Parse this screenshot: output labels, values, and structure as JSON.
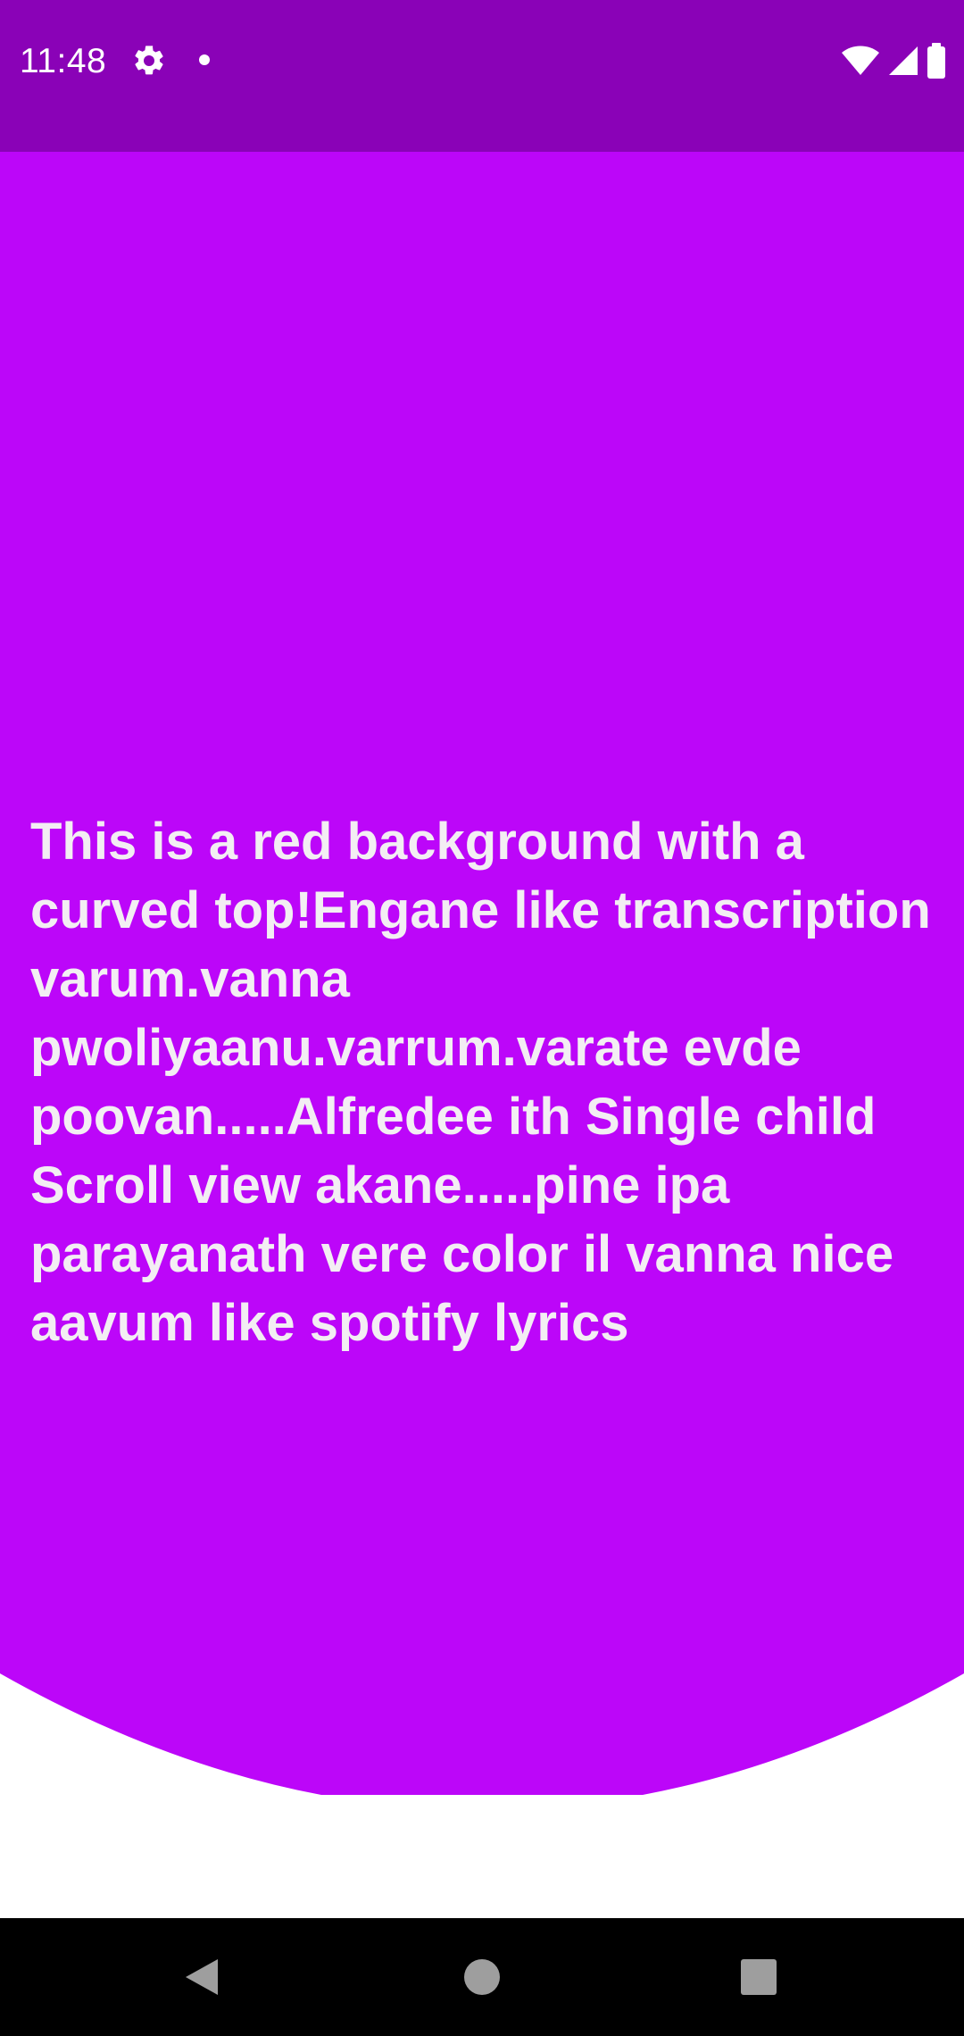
{
  "status_bar": {
    "time": "11:48",
    "icons": [
      "gear-icon",
      "notification-dot-icon",
      "wifi-icon",
      "signal-icon",
      "battery-icon"
    ]
  },
  "main": {
    "text": "This is a red background with a curved top!Engane like transcription varum.vanna pwoliyaanu.varrum.varate evde poovan.....Alfredee ith Single child Scroll view akane.....pine ipa parayanath vere color il vanna nice aavum like spotify lyrics"
  },
  "nav_bar": {
    "buttons": [
      "back-icon",
      "home-icon",
      "recents-icon"
    ]
  },
  "colors": {
    "status_bar": "#8a02b7",
    "curved_background": "#bc06f9",
    "page_background": "#ffffff",
    "text": "#f3eef3",
    "nav_bar": "#000000",
    "nav_icons": "#9e9e9e"
  }
}
